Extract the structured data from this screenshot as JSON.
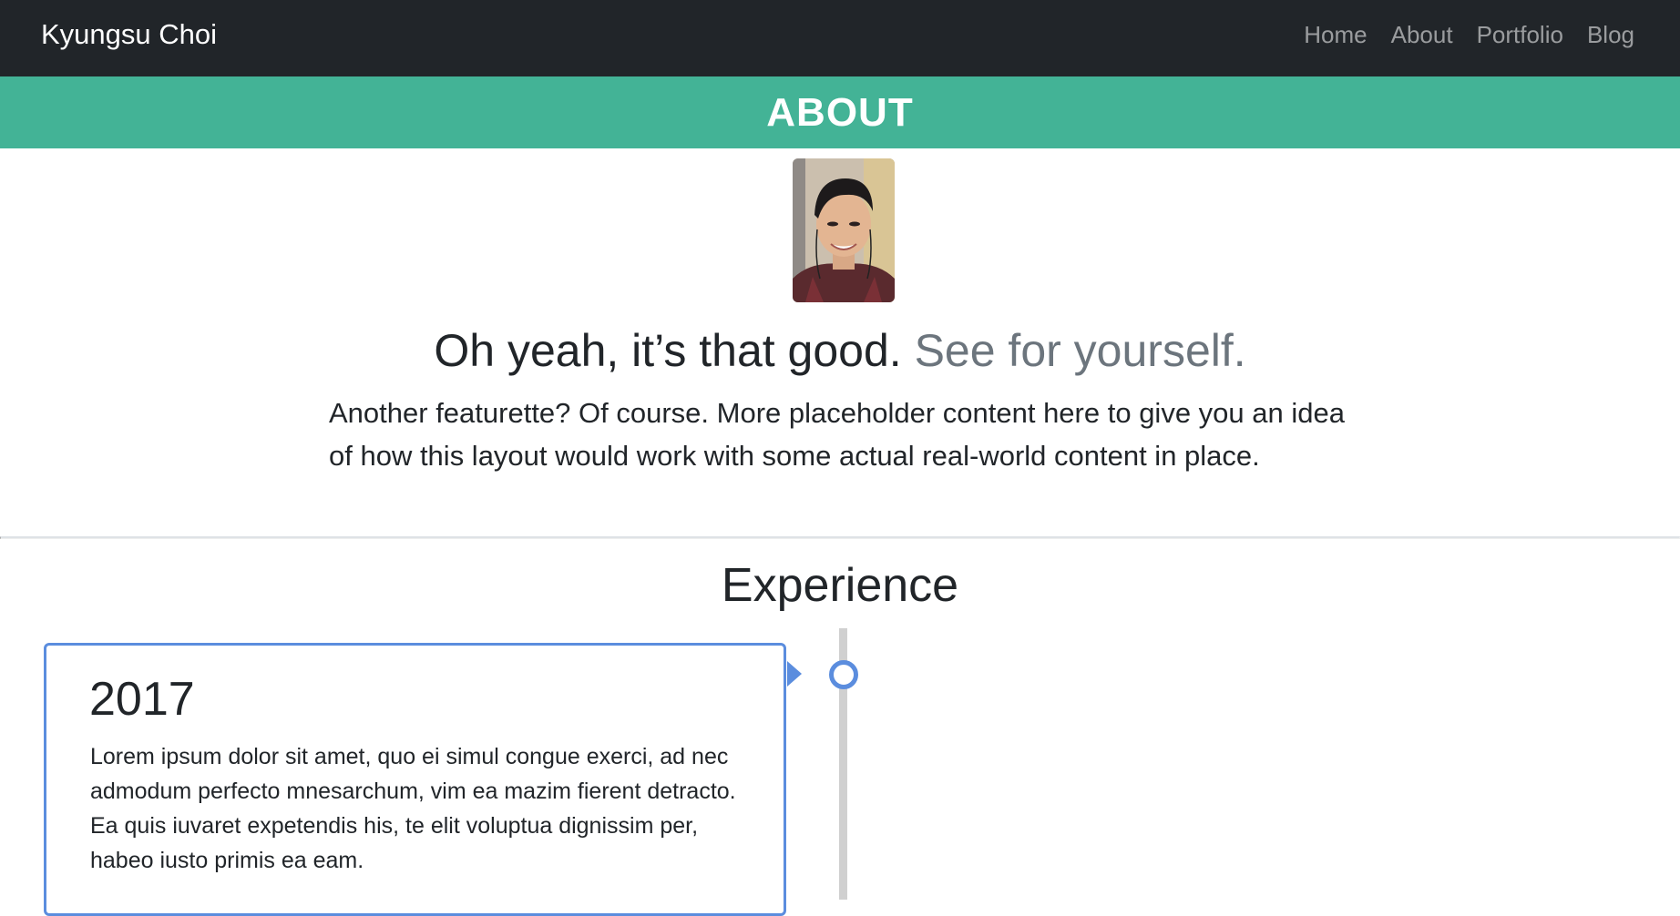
{
  "navbar": {
    "brand": "Kyungsu Choi",
    "links": [
      "Home",
      "About",
      "Portfolio",
      "Blog"
    ]
  },
  "banner": {
    "title": "ABOUT",
    "color": "#43b396"
  },
  "featurette": {
    "headline_main": "Oh yeah, it’s that good.",
    "headline_muted": "See for yourself.",
    "lead": "Another featurette? Of course. More placeholder content here to give you an idea of how this layout would work with some actual real-world content in place."
  },
  "experience": {
    "title": "Experience",
    "items": [
      {
        "year": "2017",
        "text": "Lorem ipsum dolor sit amet, quo ei simul congue exerci, ad nec admodum perfecto mnesarchum, vim ea mazim fierent detracto. Ea quis iuvaret expetendis his, te elit voluptua dignissim per, habeo iusto primis ea eam."
      }
    ]
  },
  "colors": {
    "navbar": "#212529",
    "accent": "#5b8dde",
    "muted": "#6c757d"
  }
}
